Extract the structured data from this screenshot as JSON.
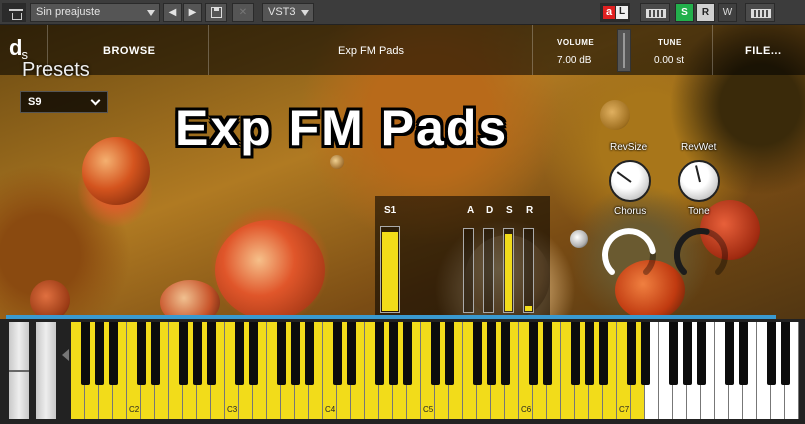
{
  "toolbar": {
    "preset_dropdown": "Sin preajuste",
    "prev_label": "◀",
    "next_label": "▶",
    "save_label": "💾",
    "close_label": "✕",
    "plugin_format": "VST3",
    "buttons": {
      "a": "a",
      "l": "L",
      "s": "S",
      "r": "R",
      "w": "W"
    }
  },
  "header": {
    "logo": "d",
    "logo_sub": "s",
    "browse": "BROWSE",
    "patch_name": "Exp FM Pads",
    "volume_label": "VOLUME",
    "volume_value": "7.00 dB",
    "tune_label": "TUNE",
    "tune_value": "0.00 st",
    "file_menu": "FILE..."
  },
  "presets": {
    "label": "Presets",
    "selected": "S9"
  },
  "title": "Exp FM Pads",
  "mod_panel": {
    "s1_label": "S1",
    "s1_value": 0.93,
    "adsr_labels": [
      "A",
      "D",
      "S",
      "R"
    ],
    "adsr_values": [
      0.0,
      0.0,
      0.93,
      0.06
    ]
  },
  "knobs": {
    "revsize_label": "RevSize",
    "revwet_label": "RevWet",
    "chorus_label": "Chorus",
    "tone_label": "Tone",
    "revsize_value": 0.3,
    "revwet_value": 0.45,
    "chorus_value": 0.8,
    "tone_value": 0.55
  },
  "keyboard": {
    "octave_labels": [
      "C2",
      "C3",
      "C4",
      "C5",
      "C6",
      "C7"
    ],
    "key_color_active": "#f2dc1a",
    "key_color_inactive": "#ffffff",
    "range_color": "#3a9ad0"
  },
  "colors": {
    "accent_green": "#23b04c",
    "accent_red": "#e02020",
    "highlight_yellow": "#f2dc1a"
  }
}
